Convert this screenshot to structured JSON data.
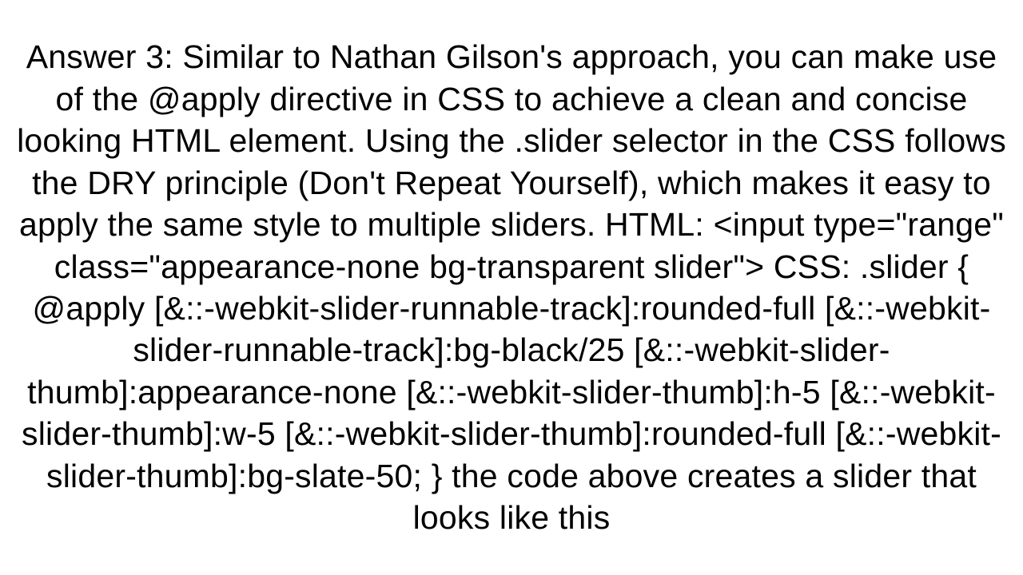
{
  "answer": {
    "text": "Answer 3: Similar to Nathan Gilson's approach, you can make use of the @apply directive in CSS to achieve a clean and concise looking HTML element. Using the .slider selector in the CSS follows the DRY principle (Don't Repeat Yourself), which makes it easy to apply the same style to multiple sliders. HTML: <input type=\"range\"      class=\"appearance-none bg-transparent slider\">  CSS: .slider {   @apply    [&::-webkit-slider-runnable-track]:rounded-full    [&::-webkit-slider-runnable-track]:bg-black/25    [&::-webkit-slider-thumb]:appearance-none    [&::-webkit-slider-thumb]:h-5    [&::-webkit-slider-thumb]:w-5    [&::-webkit-slider-thumb]:rounded-full    [&::-webkit-slider-thumb]:bg-slate-50; }  the code above creates a slider that looks like this"
  }
}
